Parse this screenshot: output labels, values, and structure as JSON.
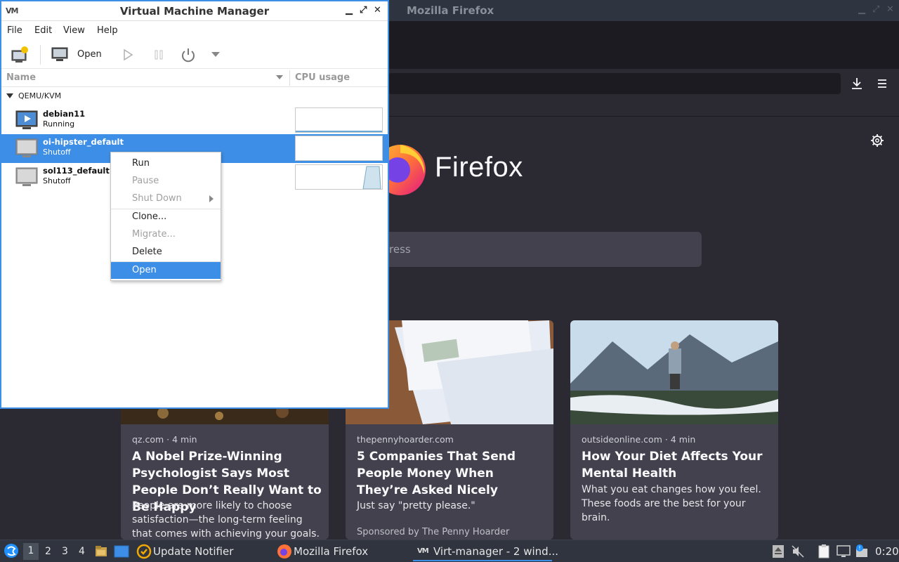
{
  "firefox": {
    "window_title": "Mozilla Firefox",
    "wordmark": "Firefox",
    "search_placeholder": "ress",
    "cards": [
      {
        "source": "qz.com · 4 min",
        "title": "A Nobel Prize-Winning Psychologist Says Most People Don’t Really Want to Be Happy",
        "description": "People are more likely to choose satisfaction—the long-term feeling that comes with achieving your goals.",
        "sponsored": ""
      },
      {
        "source": "thepennyhoarder.com",
        "title": "5 Companies That Send People Money When They’re Asked Nicely",
        "description": "Just say \"pretty please.\"",
        "sponsored": "Sponsored by The Penny Hoarder"
      },
      {
        "source": "outsideonline.com · 4 min",
        "title": "How Your Diet Affects Your Mental Health",
        "description": "What you eat changes how you feel. These foods are the best for your brain.",
        "sponsored": ""
      }
    ]
  },
  "vmm": {
    "title": "Virtual Machine Manager",
    "app_icon": "VM",
    "menu": [
      "File",
      "Edit",
      "View",
      "Help"
    ],
    "toolbar": {
      "open_label": "Open"
    },
    "columns": {
      "name": "Name",
      "cpu": "CPU usage"
    },
    "group": "QEMU/KVM",
    "vms": [
      {
        "name": "debian11",
        "status": "Running",
        "icon": "running-vm-icon"
      },
      {
        "name": "oi-hipster_default",
        "status": "Shutoff",
        "icon": "vm-icon"
      },
      {
        "name": "sol113_default",
        "status": "Shutoff",
        "icon": "vm-icon"
      }
    ],
    "context_menu": {
      "run": "Run",
      "pause": "Pause",
      "shutdown": "Shut Down",
      "clone": "Clone...",
      "migrate": "Migrate...",
      "delete": "Delete",
      "open": "Open"
    }
  },
  "taskbar": {
    "workspaces": [
      "1",
      "2",
      "3",
      "4"
    ],
    "active_workspace": "1",
    "tasks": {
      "update": "Update Notifier",
      "firefox": "Mozilla Firefox",
      "virt": "Virt-manager - 2 wind..."
    },
    "clock": "0:20"
  },
  "colors": {
    "accent": "#3d8ee6",
    "firefox_bg": "#2b2a33",
    "card_bg": "#42414d",
    "taskbar_bg": "#2f343f"
  }
}
